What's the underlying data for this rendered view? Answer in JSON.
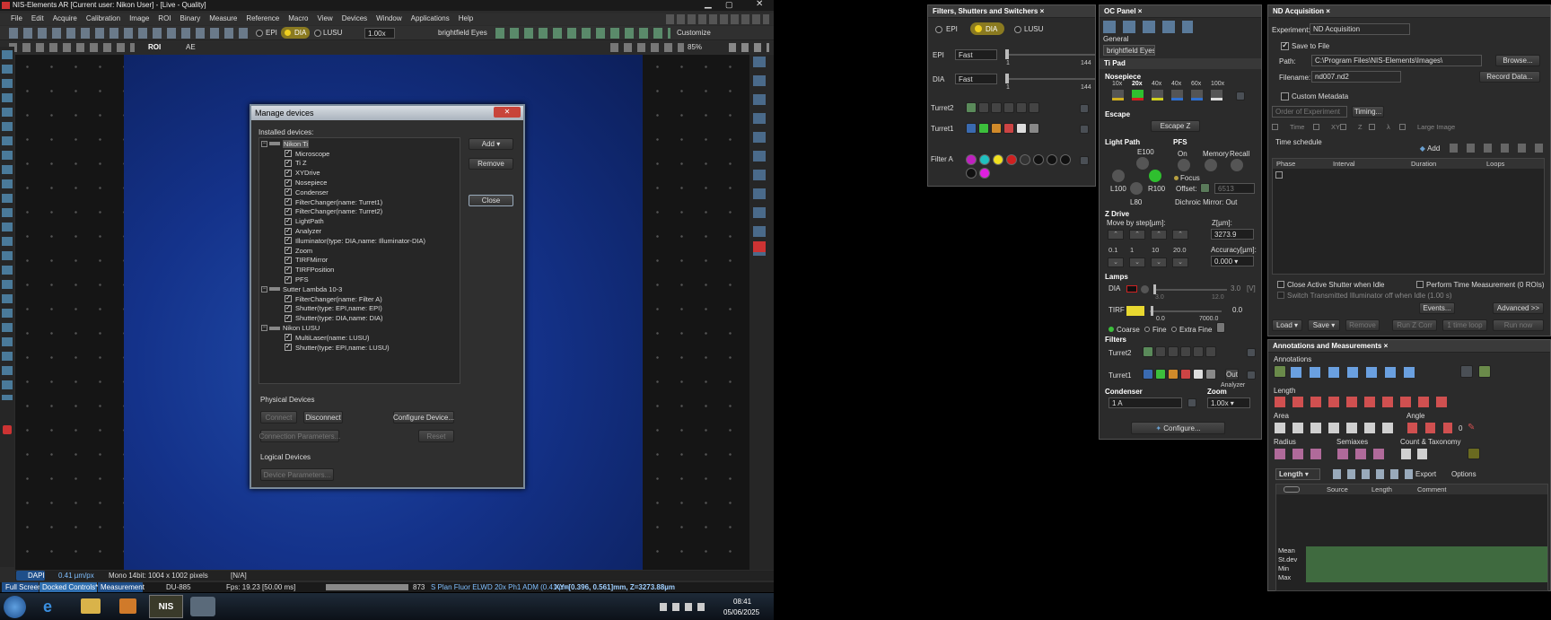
{
  "window": {
    "title": "NIS-Elements AR [Current user: Nikon User] - [Live - Quality]"
  },
  "menu": [
    "File",
    "Edit",
    "Acquire",
    "Calibration",
    "Image",
    "ROI",
    "Binary",
    "Measure",
    "Reference",
    "Macro",
    "View",
    "Devices",
    "Window",
    "Applications",
    "Help"
  ],
  "toolbar": {
    "epi": "EPI",
    "dia": "DIA",
    "lusu": "LUSU",
    "zoom_value": "1.00x",
    "optical_config": "brightfield Eyes",
    "customize": "Customize"
  },
  "toolbar2": {
    "roi": "ROI",
    "ae": "AE",
    "zoom_pct": "85%"
  },
  "status": {
    "channel": "DAPI",
    "scale": "0.41 µm/px",
    "image_info": "Mono 14bit: 1004 x 1002 pixels",
    "na": "[N/A]",
    "full_screen": "Full Screen",
    "docked_controls": "Docked Controls*",
    "measurement": "Measurement",
    "camera": "DU-885",
    "fps": "Fps: 19.23 [50.00 ms]",
    "count": "873",
    "objective": "S Plan Fluor ELWD 20x Ph1 ADM (0.41 µm",
    "xy": "XY=[0.396, 0.561]mm, Z=3273.88µm"
  },
  "taskbar": {
    "time": "08:41",
    "date": "05/06/2025"
  },
  "dialog": {
    "title": "Manage devices",
    "installed_label": "Installed devices:",
    "tree": [
      {
        "label": "Nikon Ti",
        "level": 0
      },
      {
        "label": "Microscope",
        "level": 1
      },
      {
        "label": "Ti Z",
        "level": 1
      },
      {
        "label": "XYDrive",
        "level": 1
      },
      {
        "label": "Nosepiece",
        "level": 1
      },
      {
        "label": "Condenser",
        "level": 1
      },
      {
        "label": "FilterChanger(name: Turret1)",
        "level": 1
      },
      {
        "label": "FilterChanger(name: Turret2)",
        "level": 1
      },
      {
        "label": "LightPath",
        "level": 1
      },
      {
        "label": "Analyzer",
        "level": 1
      },
      {
        "label": "Illuminator(type: DIA,name: Illuminator-DIA)",
        "level": 1
      },
      {
        "label": "Zoom",
        "level": 1
      },
      {
        "label": "TIRFMirror",
        "level": 1
      },
      {
        "label": "TIRFPosition",
        "level": 1
      },
      {
        "label": "PFS",
        "level": 1
      },
      {
        "label": "Sutter Lambda 10-3",
        "level": 0
      },
      {
        "label": "FilterChanger(name: Filter A)",
        "level": 1
      },
      {
        "label": "Shutter(type: EPI,name: EPI)",
        "level": 1
      },
      {
        "label": "Shutter(type: DIA,name: DIA)",
        "level": 1
      },
      {
        "label": "Nikon LUSU",
        "level": 0
      },
      {
        "label": "MultiLaser(name: LUSU)",
        "level": 1
      },
      {
        "label": "Shutter(type: EPI,name: LUSU)",
        "level": 1
      }
    ],
    "add": "Add",
    "remove": "Remove",
    "close": "Close",
    "physical_label": "Physical Devices",
    "connect": "Connect",
    "disconnect": "Disconnect",
    "configure_device": "Configure Device...",
    "connection_params": "Connection Parameters...",
    "reset": "Reset",
    "logical_label": "Logical Devices",
    "device_params": "Device Parameters..."
  },
  "filters_panel": {
    "title": "Filters, Shutters and Switchers",
    "epi": "EPI",
    "dia": "DIA",
    "lusu": "LUSU",
    "epi_row": "EPI",
    "dia_row": "DIA",
    "fast1": "Fast",
    "fast2": "Fast",
    "one1": "1",
    "max1": "144",
    "one2": "1",
    "max2": "144",
    "turret2": "Turret2",
    "turret1": "Turret1",
    "filter_a": "Filter A"
  },
  "oc_panel": {
    "title": "OC Panel",
    "general": "General",
    "brightfield": "brightfield Eyes"
  },
  "ti_pad": {
    "title": "Ti Pad",
    "nosepiece": "Nosepiece",
    "objectives": [
      "10x",
      "20x",
      "40x",
      "40x",
      "60x",
      "100x"
    ],
    "escape": "Escape",
    "escape_z": "Escape Z",
    "light_path": "Light Path",
    "e100": "E100",
    "l100": "L100",
    "r100": "R100",
    "l80": "L80",
    "pfs": "PFS",
    "on": "On",
    "memory": "Memory",
    "recall": "Recall",
    "focus": "Focus",
    "offset": "Offset:",
    "offset_value": "6513",
    "dichroic": "Dichroic Mirror: Out",
    "z_drive": "Z Drive",
    "move_by_step": "Move by step[µm]:",
    "z_um": "Z[µm]:",
    "z_value": "3273.9",
    "steps": [
      "0.1",
      "1",
      "10",
      "20.0"
    ],
    "accuracy": "Accuracy[µm]:",
    "accuracy_value": "0.000",
    "lamps": "Lamps",
    "dia": "DIA",
    "dia_val": "3.0",
    "dia_min": "3.0",
    "dia_max": "12.0",
    "dia_unit": "[V]",
    "tirf": "TIRF",
    "tirf_min": "0.0",
    "tirf_max": "7000.0",
    "tirf_val": "0.0",
    "coarse": "Coarse",
    "fine": "Fine",
    "extra_fine": "Extra Fine",
    "filters": "Filters",
    "turret2": "Turret2",
    "turret1": "Turret1",
    "out": "Out",
    "analyzer": "Analyzer",
    "condenser": "Condenser",
    "condenser_value": "1 A",
    "zoom": "Zoom",
    "zoom_value": "1.00x",
    "configure": "Configure..."
  },
  "nd": {
    "title": "ND Acquisition",
    "experiment_label": "Experiment:",
    "experiment": "ND Acquisition",
    "save_to_file": "Save to File",
    "path_label": "Path:",
    "path": "C:\\Program Files\\NIS-Elements\\Images\\",
    "browse": "Browse...",
    "filename_label": "Filename:",
    "filename": "nd007.nd2",
    "record_data": "Record Data...",
    "custom_metadata": "Custom Metadata",
    "order": "Order of Experiment",
    "timing": "Timing...",
    "tabs": [
      "Time",
      "XY",
      "Z",
      "λ",
      "Large Image"
    ],
    "time_schedule": "Time schedule",
    "add": "Add",
    "cols": [
      "Phase",
      "Interval",
      "Duration",
      "Loops"
    ],
    "close_shutter": "Close Active Shutter when Idle",
    "perform_time": "Perform Time Measurement (0 ROIs)",
    "switch_trans": "Switch Transmitted Illuminator off when Idle (1.00 s)",
    "events": "Events...",
    "advanced": "Advanced >>",
    "load": "Load",
    "save": "Save",
    "remove": "Remove",
    "run_z": "Run Z Corr",
    "time_loop": "1 time loop",
    "run_now": "Run now"
  },
  "annotations": {
    "title": "Annotations and Measurements",
    "annotations": "Annotations",
    "length": "Length",
    "area": "Area",
    "angle": "Angle",
    "angle_value": "0",
    "radius": "Radius",
    "semiaxes": "Semiaxes",
    "count": "Count & Taxonomy",
    "length_dd": "Length",
    "export": "Export",
    "options": "Options",
    "cols": [
      "Source",
      "Length",
      "Comment"
    ],
    "stats": [
      "Mean",
      "St.dev",
      "Min",
      "Max"
    ]
  },
  "colors": {
    "accent_green": "#3cbf3c",
    "image_blue": "#1b3a8a"
  }
}
